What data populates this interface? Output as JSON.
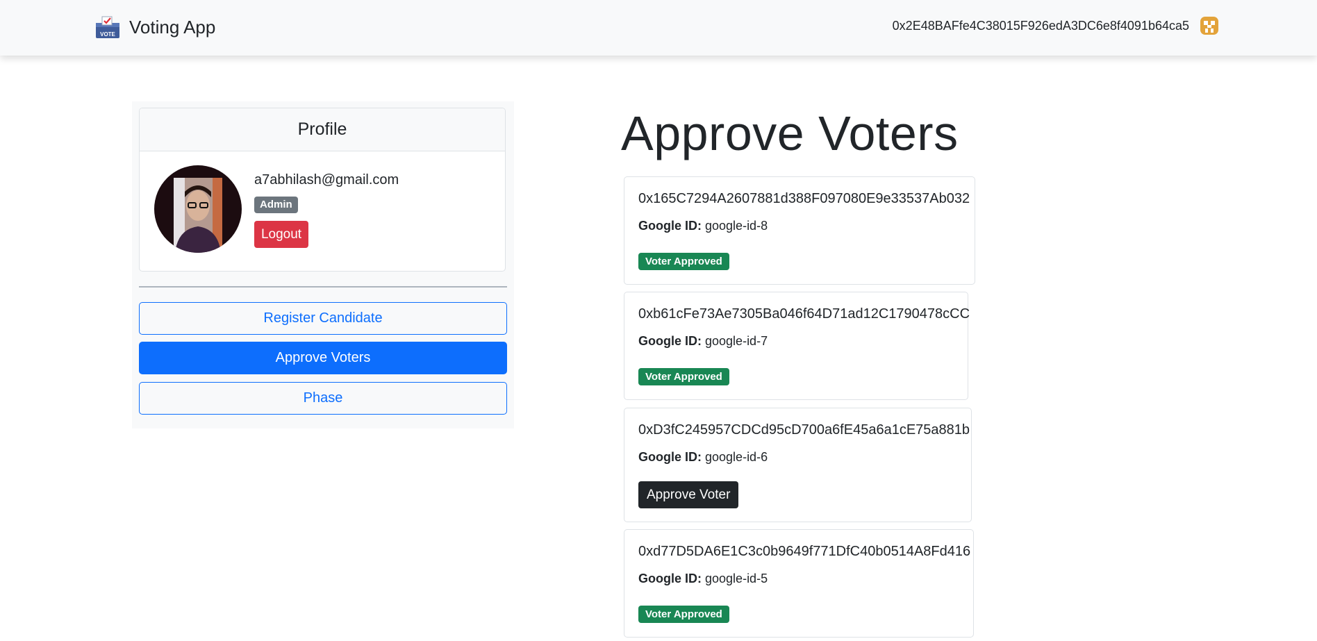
{
  "navbar": {
    "brand": "Voting App",
    "brand_icon": "ballot-box-icon",
    "wallet_address": "0x2E48BAFfe4C38015F926edA3DC6e8f4091b64ca5",
    "wallet_avatar_icon": "identicon-icon"
  },
  "sidebar": {
    "profile": {
      "header": "Profile",
      "email": "a7abhilash@gmail.com",
      "role_badge": "Admin",
      "logout_label": "Logout"
    },
    "nav": [
      {
        "label": "Register Candidate",
        "active": false
      },
      {
        "label": "Approve Voters",
        "active": true
      },
      {
        "label": "Phase",
        "active": false
      }
    ]
  },
  "main": {
    "title": "Approve Voters",
    "google_id_label": "Google ID:",
    "voters": [
      {
        "address": "0x165C7294A2607881d388F097080E9e33537Ab032",
        "google_id": "google-id-8",
        "status": "Voter Approved"
      },
      {
        "address": "0xb61cFe73Ae7305Ba046f64D71ad12C1790478cCC",
        "google_id": "google-id-7",
        "status": "Voter Approved"
      },
      {
        "address": "0xD3fC245957CDCd95cD700a6fE45a6a1cE75a881b",
        "google_id": "google-id-6",
        "action": "Approve Voter"
      },
      {
        "address": "0xd77D5DA6E1C3c0b9649f771DfC40b0514A8Fd416",
        "google_id": "google-id-5",
        "status": "Voter Approved"
      }
    ]
  },
  "colors": {
    "primary": "#0d6efd",
    "danger": "#dc3545",
    "success": "#198754",
    "secondary": "#6c757d",
    "dark": "#212529"
  }
}
